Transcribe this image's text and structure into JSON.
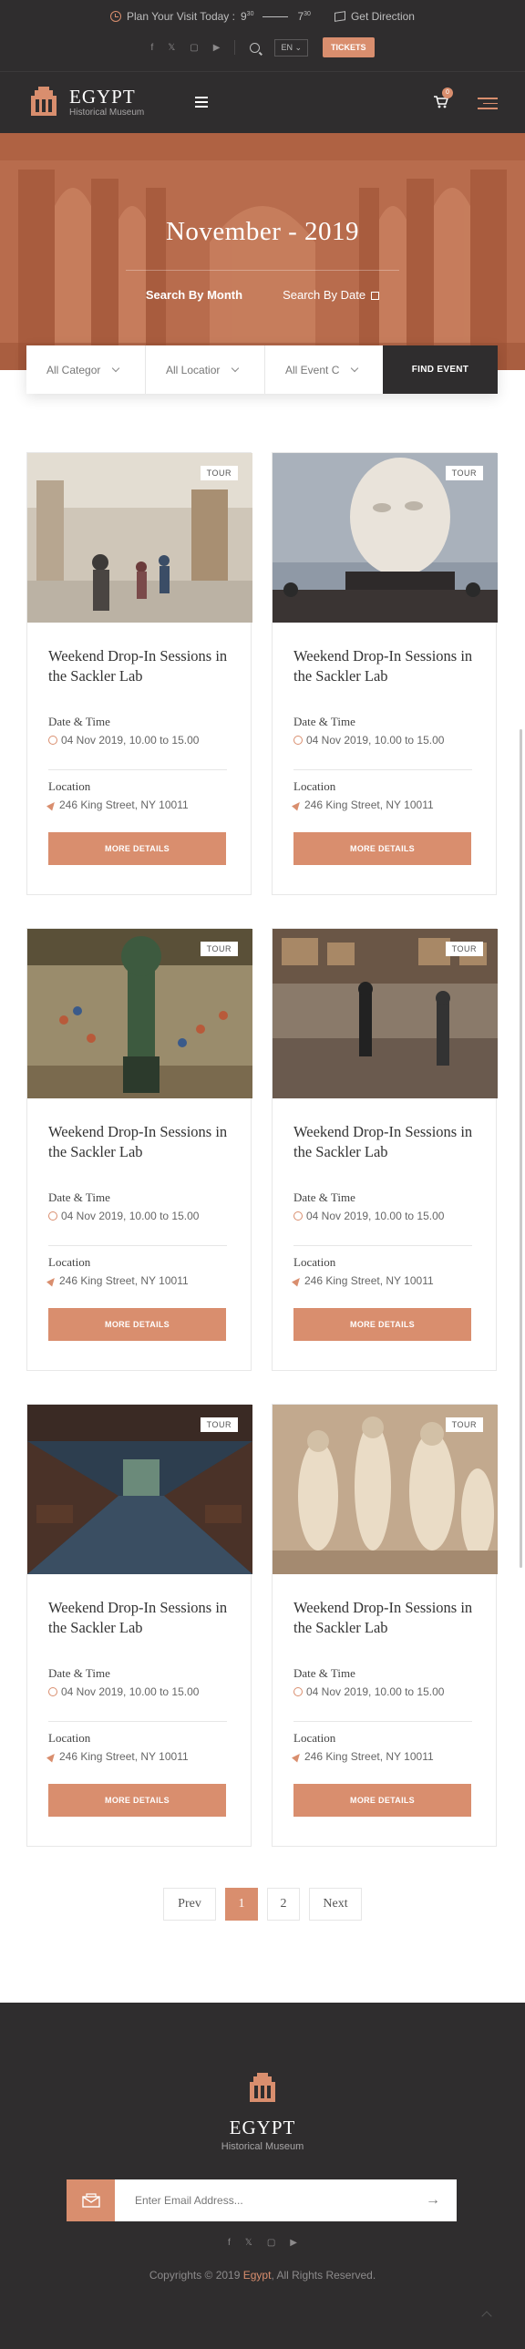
{
  "topbar": {
    "visit_label": "Plan Your Visit Today :",
    "open_hour": "9",
    "open_min": "30",
    "close_hour": "7",
    "close_min": "30",
    "direction_label": "Get Direction",
    "social_icons": [
      "facebook-icon",
      "twitter-icon",
      "instagram-icon",
      "youtube-icon"
    ],
    "lang": "EN",
    "tickets_label": "TICKETS"
  },
  "nav": {
    "brand_name": "EGYPT",
    "brand_sub": "Historical Museum",
    "cart_count": "0"
  },
  "hero": {
    "title": "November - 2019",
    "filter_month": "Search By Month",
    "filter_date": "Search By Date"
  },
  "search": {
    "category": "All Categor",
    "location": "All Locatior",
    "event": "All Event C",
    "find_label": "FIND EVENT"
  },
  "cards": [
    {
      "tag": "TOUR",
      "title": "Weekend Drop-In Sessions in the Sackler Lab",
      "date_label": "Date & Time",
      "date_value": "04 Nov 2019, 10.00 to 15.00",
      "location_label": "Location",
      "location_value": "246 King Street, NY 10011",
      "button": "MORE DETAILS"
    },
    {
      "tag": "TOUR",
      "title": "Weekend Drop-In Sessions in the Sackler Lab",
      "date_label": "Date & Time",
      "date_value": "04 Nov 2019, 10.00 to 15.00",
      "location_label": "Location",
      "location_value": "246 King Street, NY 10011",
      "button": "MORE DETAILS"
    },
    {
      "tag": "TOUR",
      "title": "Weekend Drop-In Sessions in the Sackler Lab",
      "date_label": "Date & Time",
      "date_value": "04 Nov 2019, 10.00 to 15.00",
      "location_label": "Location",
      "location_value": "246 King Street, NY 10011",
      "button": "MORE DETAILS"
    },
    {
      "tag": "TOUR",
      "title": "Weekend Drop-In Sessions in the Sackler Lab",
      "date_label": "Date & Time",
      "date_value": "04 Nov 2019, 10.00 to 15.00",
      "location_label": "Location",
      "location_value": "246 King Street, NY 10011",
      "button": "MORE DETAILS"
    },
    {
      "tag": "TOUR",
      "title": "Weekend Drop-In Sessions in the Sackler Lab",
      "date_label": "Date & Time",
      "date_value": "04 Nov 2019, 10.00 to 15.00",
      "location_label": "Location",
      "location_value": "246 King Street, NY 10011",
      "button": "MORE DETAILS"
    },
    {
      "tag": "TOUR",
      "title": "Weekend Drop-In Sessions in the Sackler Lab",
      "date_label": "Date & Time",
      "date_value": "04 Nov 2019, 10.00 to 15.00",
      "location_label": "Location",
      "location_value": "246 King Street, NY 10011",
      "button": "MORE DETAILS"
    }
  ],
  "pagination": {
    "prev": "Prev",
    "pages": [
      "1",
      "2"
    ],
    "current": "1",
    "next": "Next"
  },
  "footer": {
    "brand_name": "EGYPT",
    "brand_sub": "Historical Museum",
    "email_placeholder": "Enter Email Address...",
    "copyright_prefix": "Copyrights © 2019",
    "copyright_brand": "Egypt",
    "copyright_suffix": ", All Rights Reserved."
  },
  "colors": {
    "accent": "#d98e6e",
    "dark": "#2f2d2e"
  }
}
